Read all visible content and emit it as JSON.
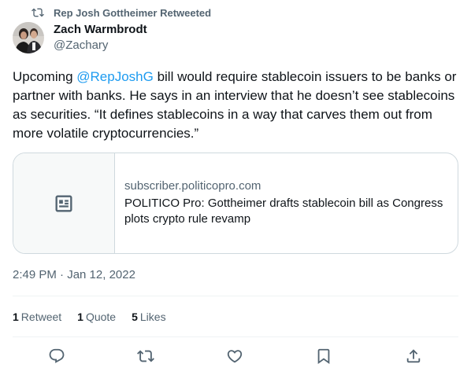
{
  "retweet": {
    "label": "Rep Josh Gottheimer Retweeted"
  },
  "author": {
    "name": "Zach Warmbrodt",
    "handle": "@Zachary"
  },
  "tweet": {
    "text_before": "Upcoming ",
    "mention": "@RepJoshG",
    "text_after": " bill would require stablecoin issuers to be banks or partner with banks. He says in an interview that he doesn’t see stablecoins as securities. “It defines stablecoins in a way that carves them out from more volatile cryptocurrencies.”"
  },
  "card": {
    "domain": "subscriber.politicopro.com",
    "title": "POLITICO Pro: Gottheimer drafts stablecoin bill as Congress plots crypto rule revamp"
  },
  "timestamp": "2:49 PM · Jan 12, 2022",
  "stats": {
    "retweets_count": "1",
    "retweets_label": "Retweet",
    "quotes_count": "1",
    "quotes_label": "Quote",
    "likes_count": "5",
    "likes_label": "Likes"
  },
  "colors": {
    "accent": "#1d9bf0",
    "secondary_text": "#536471",
    "border": "#cfd9de"
  },
  "icons": [
    "retweet-icon",
    "article-icon",
    "reply-icon",
    "like-icon",
    "bookmark-icon",
    "share-icon"
  ]
}
